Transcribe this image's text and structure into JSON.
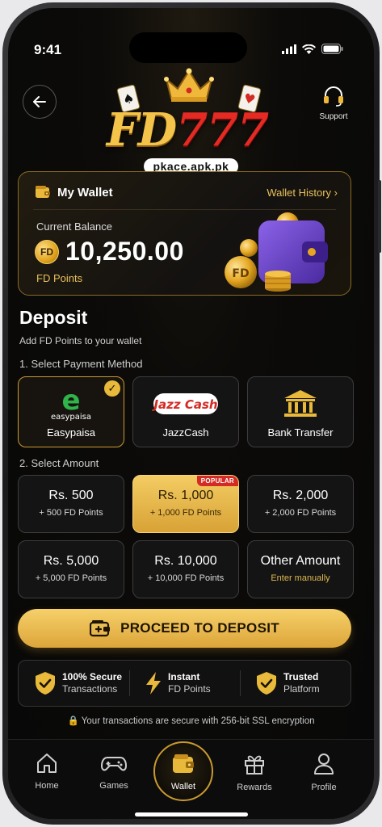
{
  "status_bar": {
    "time": "9:41"
  },
  "header": {
    "back_icon": "arrow-left-icon",
    "support_label": "Support",
    "support_icon": "headset-icon"
  },
  "logo": {
    "text_gold": "FD",
    "text_red": "777",
    "watermark": "pkace.apk.pk"
  },
  "wallet": {
    "title": "My Wallet",
    "history_link": "Wallet History",
    "balance_label": "Current Balance",
    "coin_label": "FD",
    "balance": "10,250.00",
    "unit": "FD Points"
  },
  "deposit": {
    "title": "Deposit",
    "subtitle": "Add FD Points to your wallet",
    "step1": "1. Select Payment Method",
    "step2": "2. Select Amount",
    "methods": [
      {
        "name": "Easypaisa",
        "logo_text": "easypaisa",
        "selected": true
      },
      {
        "name": "JazzCash",
        "logo_text": "Jazz Cash",
        "selected": false
      },
      {
        "name": "Bank Transfer",
        "selected": false
      }
    ],
    "amounts": [
      {
        "amount": "Rs. 500",
        "points": "+ 500 FD Points"
      },
      {
        "amount": "Rs. 1,000",
        "points": "+ 1,000 FD Points",
        "badge": "POPULAR",
        "selected": true
      },
      {
        "amount": "Rs. 2,000",
        "points": "+ 2,000 FD Points"
      },
      {
        "amount": "Rs. 5,000",
        "points": "+ 5,000 FD Points"
      },
      {
        "amount": "Rs. 10,000",
        "points": "+ 10,000 FD Points"
      },
      {
        "amount": "Other Amount",
        "points": "Enter manually"
      }
    ],
    "proceed_label": "PROCEED TO DEPOSIT"
  },
  "trust": [
    {
      "title": "100% Secure",
      "sub": "Transactions",
      "icon": "shield-check-icon"
    },
    {
      "title": "Instant",
      "sub": "FD Points",
      "icon": "lightning-icon"
    },
    {
      "title": "Trusted",
      "sub": "Platform",
      "icon": "shield-check-icon"
    }
  ],
  "ssl_note": "Your transactions are secure with 256-bit SSL encryption",
  "nav": {
    "home": "Home",
    "games": "Games",
    "wallet": "Wallet",
    "rewards": "Rewards",
    "profile": "Profile"
  },
  "colors": {
    "gold": "#e8c15a",
    "accent_red": "#d42a24",
    "background": "#080808"
  }
}
